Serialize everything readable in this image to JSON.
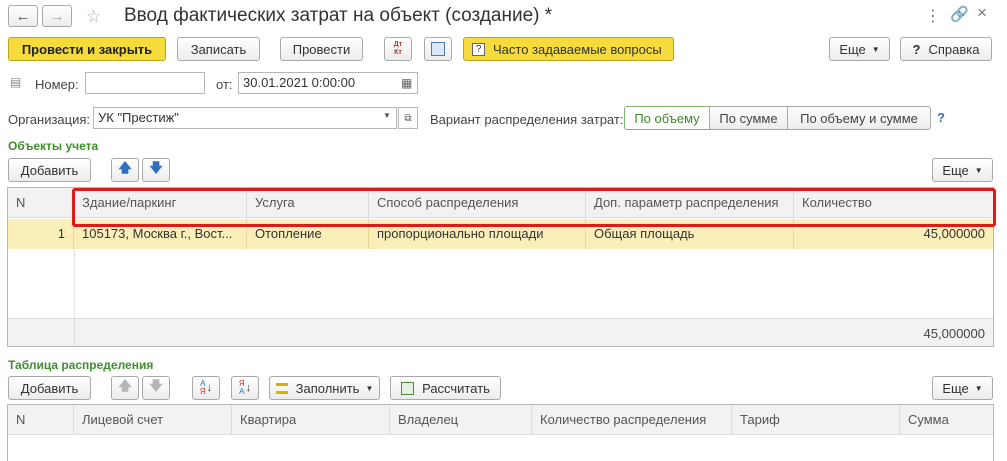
{
  "window": {
    "title": "Ввод фактических затрат на объект (создание) *"
  },
  "toolbar": {
    "post_close": "Провести и закрыть",
    "save": "Записать",
    "post": "Провести",
    "dtkt_icon": "Дт Кт",
    "faq": "Часто задаваемые вопросы",
    "more": "Еще",
    "help": "Справка"
  },
  "header": {
    "number_label": "Номер:",
    "number_value": "",
    "date_label": "от:",
    "date_value": "30.01.2021  0:00:00",
    "org_label": "Организация:",
    "org_value": "УК \"Престиж\"",
    "variant_label": "Вариант распределения затрат:",
    "variant_options": [
      "По объему",
      "По сумме",
      "По объему и сумме"
    ],
    "variant_selected": "По объему",
    "help_mark": "?"
  },
  "objects": {
    "title": "Объекты учета",
    "add": "Добавить",
    "more": "Еще",
    "columns": [
      "N",
      "Здание/паркинг",
      "Услуга",
      "Способ распределения",
      "Доп. параметр распределения",
      "Количество"
    ],
    "rows": [
      {
        "n": "1",
        "building": "105173, Москва г., Вост...",
        "service": "Отопление",
        "method": "пропорционально площади",
        "param": "Общая площадь",
        "qty": "45,000000"
      }
    ],
    "total_qty": "45,000000"
  },
  "distribution": {
    "title": "Таблица распределения",
    "add": "Добавить",
    "fill": "Заполнить",
    "calculate": "Рассчитать",
    "more": "Еще",
    "columns": [
      "N",
      "Лицевой счет",
      "Квартира",
      "Владелец",
      "Количество распределения",
      "Тариф",
      "Сумма"
    ]
  },
  "colors": {
    "accent_yellow": "#f5dc3c",
    "selected_row": "#fbefb9",
    "highlight_frame": "#e01a1a",
    "section_green": "#3f8f2e"
  }
}
